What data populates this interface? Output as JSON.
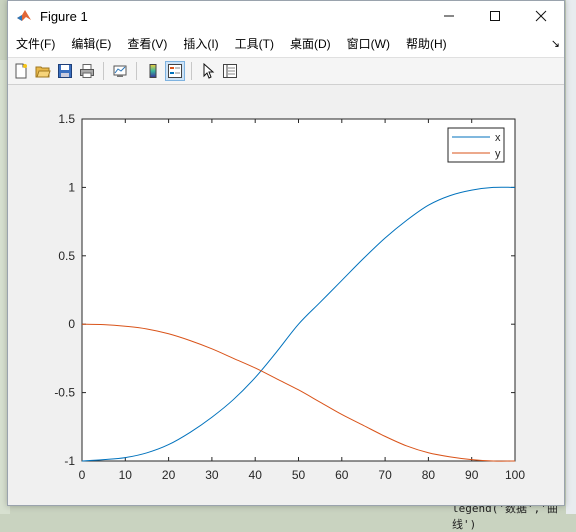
{
  "window": {
    "title": "Figure 1"
  },
  "menu": [
    {
      "label": "文件(F)"
    },
    {
      "label": "编辑(E)"
    },
    {
      "label": "查看(V)"
    },
    {
      "label": "插入(I)"
    },
    {
      "label": "工具(T)"
    },
    {
      "label": "桌面(D)"
    },
    {
      "label": "窗口(W)"
    },
    {
      "label": "帮助(H)"
    }
  ],
  "toolbar_icons": [
    "new-figure-icon",
    "open-file-icon",
    "save-icon",
    "print-icon",
    "link-plot-icon",
    "colorbar-icon",
    "legend-icon",
    "edit-plot-icon",
    "property-inspector-icon"
  ],
  "background_text": {
    "code_line": "legend('数据','曲线')"
  },
  "colors": {
    "series_x": "#0072bd",
    "series_y": "#d95319"
  },
  "chart_data": {
    "type": "line",
    "title": "",
    "xlabel": "",
    "ylabel": "",
    "xlim": [
      0,
      100
    ],
    "ylim": [
      -1,
      1.5
    ],
    "xticks": [
      0,
      10,
      20,
      30,
      40,
      50,
      60,
      70,
      80,
      90,
      100
    ],
    "yticks": [
      -1,
      -0.5,
      0,
      0.5,
      1,
      1.5
    ],
    "ytick_labels": [
      "-1",
      "-0.5",
      "0",
      "0.5",
      "1",
      "1.5"
    ],
    "legend_position": "top-right",
    "grid": false,
    "series": [
      {
        "name": "x",
        "x": [
          0,
          5,
          10,
          15,
          20,
          25,
          30,
          35,
          40,
          45,
          50,
          55,
          60,
          65,
          70,
          75,
          80,
          85,
          90,
          95,
          100
        ],
        "values": [
          -1.0,
          -0.99,
          -0.975,
          -0.94,
          -0.88,
          -0.79,
          -0.68,
          -0.55,
          -0.39,
          -0.2,
          0.0,
          0.16,
          0.32,
          0.48,
          0.63,
          0.76,
          0.87,
          0.94,
          0.98,
          1.0,
          1.0
        ]
      },
      {
        "name": "y",
        "x": [
          0,
          5,
          10,
          15,
          20,
          25,
          30,
          35,
          40,
          45,
          50,
          55,
          60,
          65,
          70,
          75,
          80,
          85,
          90,
          95,
          100
        ],
        "values": [
          0.0,
          -0.003,
          -0.015,
          -0.035,
          -0.07,
          -0.12,
          -0.18,
          -0.25,
          -0.32,
          -0.4,
          -0.48,
          -0.57,
          -0.66,
          -0.74,
          -0.82,
          -0.89,
          -0.94,
          -0.97,
          -0.99,
          -1.0,
          -1.0
        ]
      }
    ]
  }
}
